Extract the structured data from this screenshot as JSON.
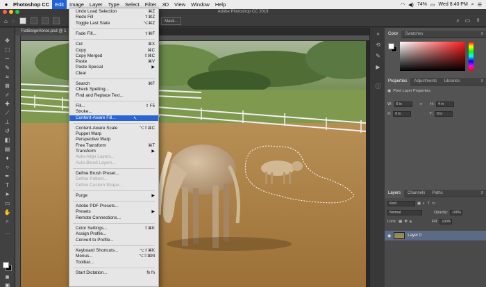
{
  "menubar": {
    "apple": "",
    "app_name": "Photoshop CC",
    "items": [
      "Edit",
      "Image",
      "Layer",
      "Type",
      "Select",
      "Filter",
      "3D",
      "View",
      "Window",
      "Help"
    ],
    "battery": "74%",
    "clock": "Wed 8:40 PM"
  },
  "window": {
    "title": "Adobe Photoshop CC 2019"
  },
  "options_bar": {
    "select_mask": "Mask..."
  },
  "document": {
    "tab_title": "FlatBeigeHorse.psd @ 1"
  },
  "edit_menu": {
    "items": [
      {
        "label": "Undo Load Selection",
        "shortcut": "⌘Z"
      },
      {
        "label": "Redo Fill",
        "shortcut": "⇧⌘Z"
      },
      {
        "label": "Toggle Last State",
        "shortcut": "⌥⌘Z"
      },
      {
        "sep": true
      },
      {
        "label": "Fade Fill...",
        "shortcut": "⇧⌘F"
      },
      {
        "sep": true
      },
      {
        "label": "Cut",
        "shortcut": "⌘X"
      },
      {
        "label": "Copy",
        "shortcut": "⌘C"
      },
      {
        "label": "Copy Merged",
        "shortcut": "⇧⌘C"
      },
      {
        "label": "Paste",
        "shortcut": "⌘V"
      },
      {
        "label": "Paste Special",
        "shortcut": "▶"
      },
      {
        "label": "Clear",
        "shortcut": ""
      },
      {
        "sep": true
      },
      {
        "label": "Search",
        "shortcut": "⌘F"
      },
      {
        "label": "Check Spelling...",
        "shortcut": ""
      },
      {
        "label": "Find and Replace Text...",
        "shortcut": ""
      },
      {
        "sep": true
      },
      {
        "label": "Fill...",
        "shortcut": "⇧ F5"
      },
      {
        "label": "Stroke...",
        "shortcut": ""
      },
      {
        "label": "Content-Aware Fill...",
        "shortcut": "",
        "highlight": true
      },
      {
        "sep": true
      },
      {
        "label": "Content-Aware Scale",
        "shortcut": "⌥⇧⌘C"
      },
      {
        "label": "Puppet Warp",
        "shortcut": ""
      },
      {
        "label": "Perspective Warp",
        "shortcut": ""
      },
      {
        "label": "Free Transform",
        "shortcut": "⌘T"
      },
      {
        "label": "Transform",
        "shortcut": "▶"
      },
      {
        "label": "Auto-Align Layers...",
        "shortcut": "",
        "disabled": true
      },
      {
        "label": "Auto-Blend Layers...",
        "shortcut": "",
        "disabled": true
      },
      {
        "sep": true
      },
      {
        "label": "Define Brush Preset...",
        "shortcut": ""
      },
      {
        "label": "Define Pattern...",
        "shortcut": "",
        "disabled": true
      },
      {
        "label": "Define Custom Shape...",
        "shortcut": "",
        "disabled": true
      },
      {
        "sep": true
      },
      {
        "label": "Purge",
        "shortcut": "▶"
      },
      {
        "sep": true
      },
      {
        "label": "Adobe PDF Presets...",
        "shortcut": ""
      },
      {
        "label": "Presets",
        "shortcut": "▶"
      },
      {
        "label": "Remote Connections...",
        "shortcut": ""
      },
      {
        "sep": true
      },
      {
        "label": "Color Settings...",
        "shortcut": "⇧⌘K"
      },
      {
        "label": "Assign Profile...",
        "shortcut": ""
      },
      {
        "label": "Convert to Profile...",
        "shortcut": ""
      },
      {
        "sep": true
      },
      {
        "label": "Keyboard Shortcuts...",
        "shortcut": "⌥⇧⌘K"
      },
      {
        "label": "Menus...",
        "shortcut": "⌥⇧⌘M"
      },
      {
        "label": "Toolbar...",
        "shortcut": ""
      },
      {
        "sep": true
      },
      {
        "label": "Start Dictation...",
        "shortcut": "fn fn"
      }
    ]
  },
  "color_panel": {
    "tabs": [
      "Color",
      "Swatches"
    ]
  },
  "properties_panel": {
    "tabs": [
      "Properties",
      "Adjustments",
      "Libraries"
    ],
    "heading": "Pixel Layer Properties",
    "w_label": "W:",
    "w_value": "6 in",
    "h_label": "H:",
    "h_value": "4 in",
    "x_label": "X:",
    "x_value": "0 in",
    "y_label": "Y:",
    "y_value": "0 in"
  },
  "layers_panel": {
    "tabs": [
      "Layers",
      "Channels",
      "Paths"
    ],
    "kind_filter": "Kind",
    "blend_mode": "Normal",
    "opacity_label": "Opacity:",
    "opacity_value": "100%",
    "lock_label": "Lock:",
    "fill_label": "Fill:",
    "fill_value": "100%",
    "layer_name": "Layer 0"
  }
}
